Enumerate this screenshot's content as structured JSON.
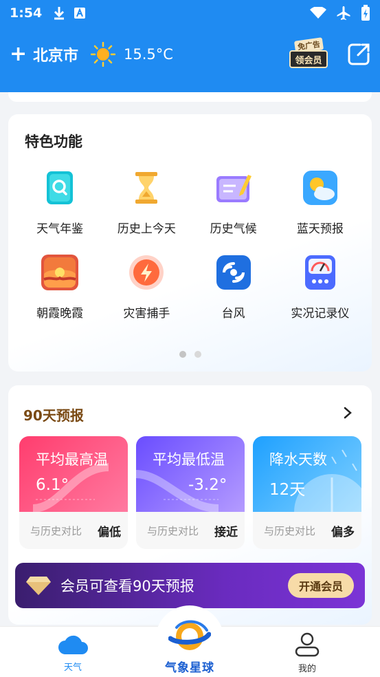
{
  "status_bar": {
    "time": "1:54"
  },
  "header": {
    "add_icon": "plus",
    "city": "北京市",
    "weather_icon": "sun-icon",
    "temperature": "15.5°C",
    "vip_tag_top": "免广告",
    "vip_tag_main": "领会员"
  },
  "features": {
    "title": "特色功能",
    "items": [
      {
        "label": "天气年鉴",
        "icon": "almanac-icon"
      },
      {
        "label": "历史上今天",
        "icon": "hourglass-icon"
      },
      {
        "label": "历史气候",
        "icon": "notebook-icon"
      },
      {
        "label": "蓝天预报",
        "icon": "sun-cloud-icon"
      },
      {
        "label": "朝霞晚霞",
        "icon": "sunset-icon"
      },
      {
        "label": "灾害捕手",
        "icon": "lightning-icon"
      },
      {
        "label": "台风",
        "icon": "typhoon-icon"
      },
      {
        "label": "实况记录仪",
        "icon": "gauge-icon"
      }
    ]
  },
  "forecast90": {
    "title": "90天预报",
    "stats": [
      {
        "title": "平均最高温",
        "value": "6.1°",
        "compare": "与历史对比",
        "result": "偏低"
      },
      {
        "title": "平均最低温",
        "value": "-3.2°",
        "compare": "与历史对比",
        "result": "接近"
      },
      {
        "title": "降水天数",
        "value": "12天",
        "compare": "与历史对比",
        "result": "偏多"
      }
    ],
    "banner_text": "会员可查看90天预报",
    "banner_button": "开通会员"
  },
  "bottom_nav": {
    "weather": "天气",
    "brand": "气象星球",
    "me": "我的"
  },
  "colors": {
    "primary": "#1f8bf2",
    "forecast_title": "#7a4a14"
  }
}
